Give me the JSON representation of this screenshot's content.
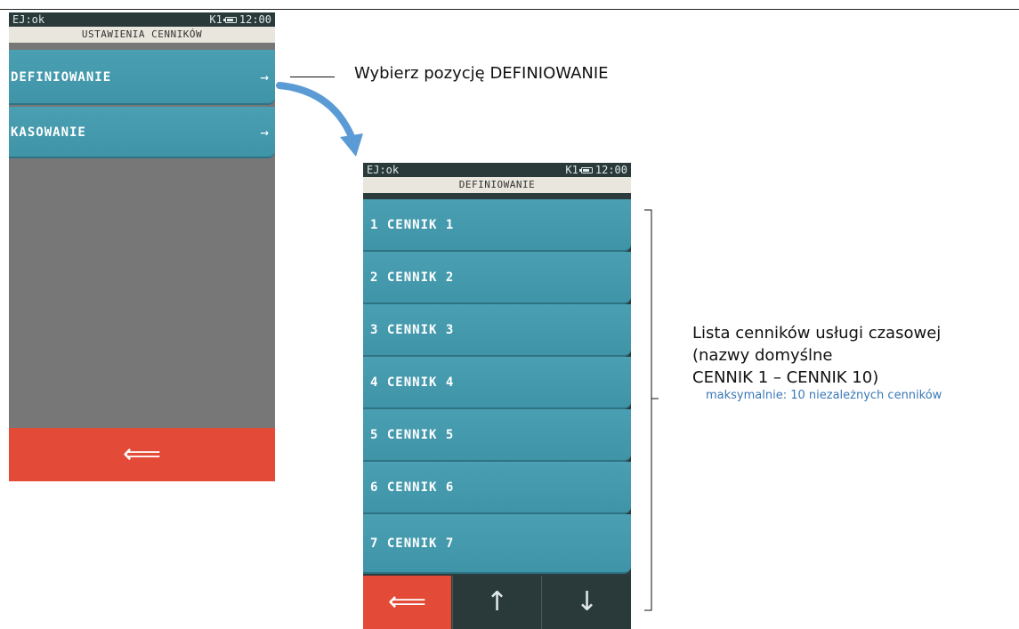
{
  "screen1": {
    "status": {
      "left": "EJ:ok",
      "right": "K1",
      "time": "12:00"
    },
    "title": "USTAWIENIA CENNIKÓW",
    "menu": [
      {
        "label": "DEFINIOWANIE",
        "arrow": "→"
      },
      {
        "label": "KASOWANIE",
        "arrow": "→"
      }
    ],
    "back_glyph": "⟸"
  },
  "screen2": {
    "status": {
      "left": "EJ:ok",
      "right": "K1",
      "time": "12:00"
    },
    "title": "DEFINIOWANIE",
    "items": [
      {
        "label": "1 CENNIK 1"
      },
      {
        "label": "2 CENNIK 2"
      },
      {
        "label": "3 CENNIK 3"
      },
      {
        "label": "4 CENNIK 4"
      },
      {
        "label": "5 CENNIK 5"
      },
      {
        "label": "6 CENNIK 6"
      },
      {
        "label": "7 CENNIK 7"
      }
    ],
    "nav": {
      "back": "⟸",
      "up": "↑",
      "down": "↓"
    }
  },
  "annotations": {
    "callout1": "Wybierz pozycję DEFINIOWANIE",
    "callout2_lines": [
      "Lista cenników usługi czasowej",
      "(nazwy domyślne",
      "CENNIK 1 – CENNIK 10)"
    ],
    "note": "maksymalnie: 10 niezależnych cenników"
  },
  "colors": {
    "menu_teal": "#4299ad",
    "back_red": "#e34a38",
    "panel_gray": "#777777",
    "status_dark": "#2a3a3a",
    "note_blue": "#3a78b8",
    "arrow_blue": "#5b9bd5"
  }
}
